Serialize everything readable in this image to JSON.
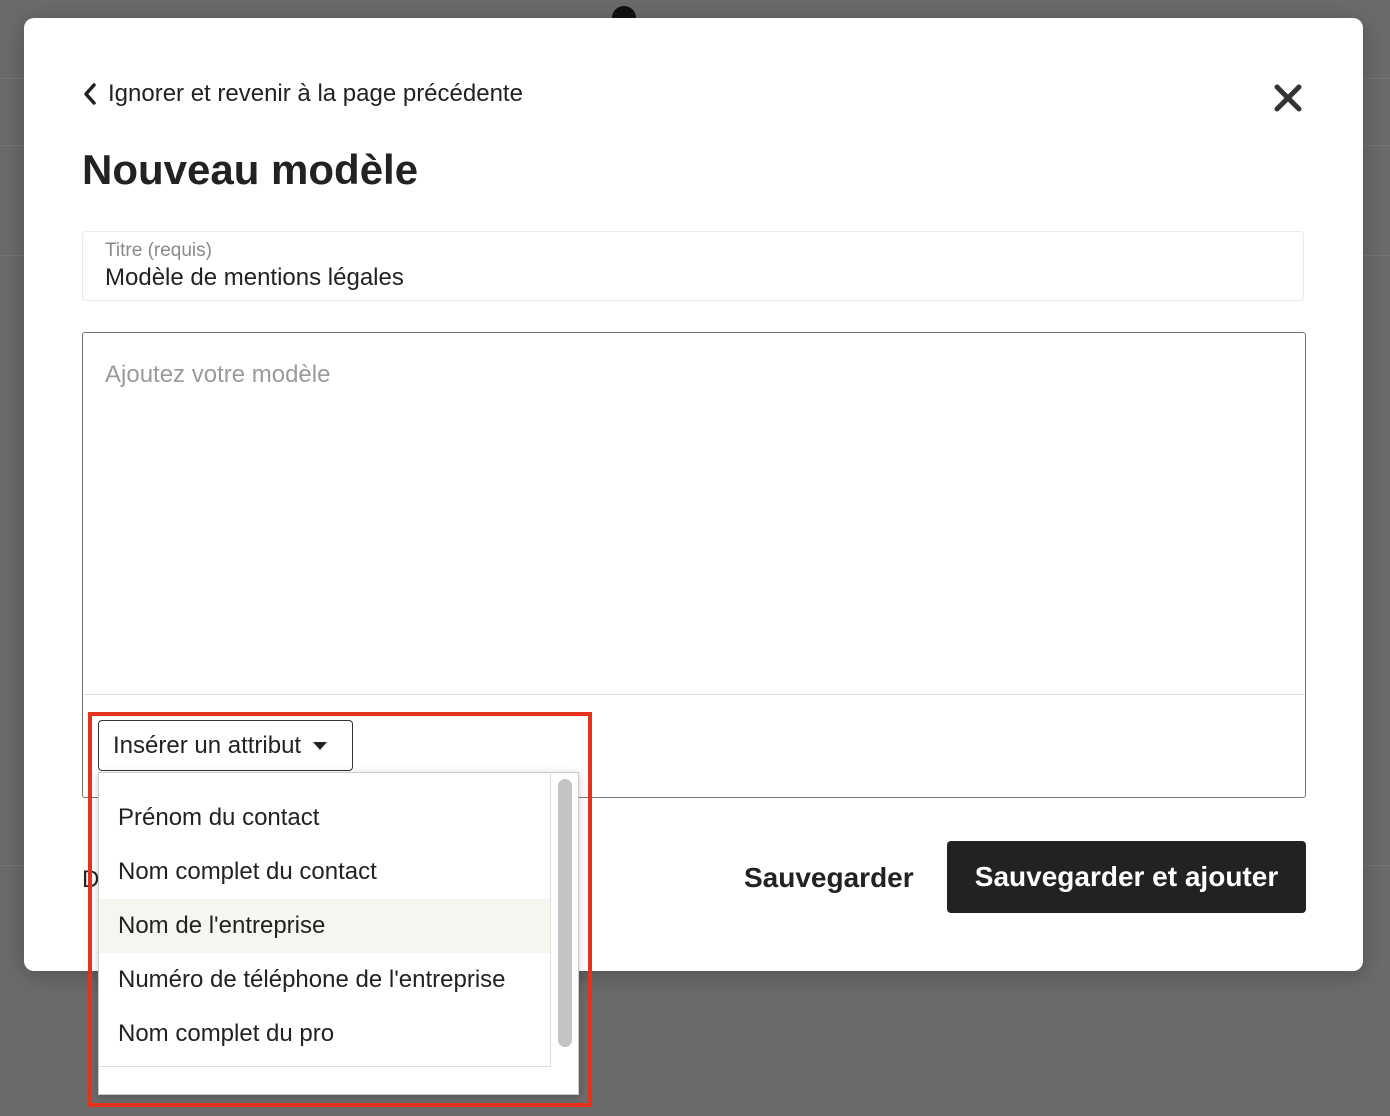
{
  "background": {
    "overlay_color": "#6b6b6b"
  },
  "modal": {
    "back_link_label": "Ignorer et revenir à la page précédente",
    "close_icon": "close-icon",
    "title": "Nouveau modèle",
    "title_field": {
      "label": "Titre (requis)",
      "value": "Modèle de mentions légales"
    },
    "editor": {
      "placeholder": "Ajoutez votre modèle"
    },
    "insert_attribute": {
      "label": "Insérer un attribut",
      "options": [
        "Prénom du contact",
        "Nom complet du contact",
        "Nom de l'entreprise",
        "Numéro de téléphone de l'entreprise",
        "Nom complet du pro"
      ],
      "highlighted_option": "Nom de l'entreprise"
    },
    "partial_text": "D",
    "actions": {
      "save_label": "Sauvegarder",
      "save_and_add_label": "Sauvegarder et ajouter"
    }
  },
  "colors": {
    "primary_button": "#222222",
    "highlight_outline": "#e5321a",
    "option_hover": "#f6f5f0"
  }
}
